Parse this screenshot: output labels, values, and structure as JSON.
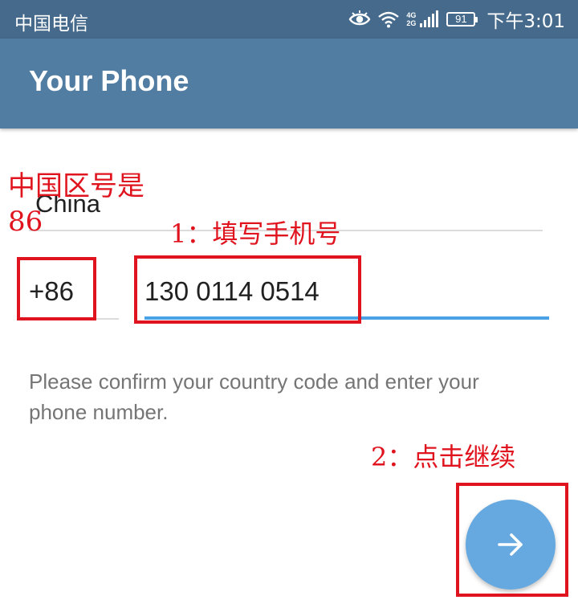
{
  "status_bar": {
    "carrier": "中国电信",
    "net_type_top": "4G",
    "net_type_bottom": "2G",
    "battery": "91",
    "time": "下午3:01",
    "icons": [
      "eye-icon",
      "wifi-icon",
      "signal-icon",
      "battery-icon"
    ]
  },
  "header": {
    "title": "Your Phone"
  },
  "form": {
    "country": "China",
    "country_code": "+86",
    "phone_number": "130 0114 0514",
    "help_text": "Please confirm your country code and enter your phone number."
  },
  "next_button": {
    "icon": "arrow-right-icon"
  },
  "annotations": {
    "country_note_line1": "中国区号是",
    "country_note_line2": "86",
    "step1": "1：填写手机号",
    "step2": "2：点击继续",
    "color": "#e0141e"
  },
  "colors": {
    "status_bar": "#456a8b",
    "app_bar": "#527da3",
    "accent": "#4ba1e6",
    "fab": "#65a9e0"
  }
}
